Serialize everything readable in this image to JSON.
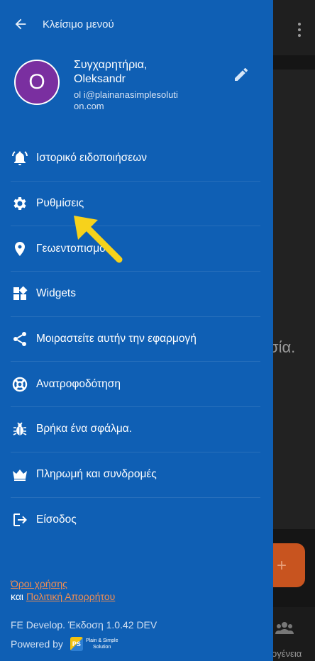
{
  "drawer": {
    "close_label": "Κλείσιμο μενού",
    "profile": {
      "avatar_letter": "O",
      "greeting_line1": "Συγχαρητήρια,",
      "greeting_line2": "Oleksandr",
      "email": "ol             i@plainanasimplesolution.com"
    },
    "menu": [
      {
        "icon": "bell-ringing-icon",
        "label": "Ιστορικό ειδοποιήσεων"
      },
      {
        "icon": "gear-icon",
        "label": "Ρυθμίσεις"
      },
      {
        "icon": "location-pin-icon",
        "label": "Γεωεντοπισμός"
      },
      {
        "icon": "widgets-icon",
        "label": "Widgets"
      },
      {
        "icon": "share-icon",
        "label": "Μοιραστείτε αυτήν την εφαρμογή"
      },
      {
        "icon": "lifebuoy-icon",
        "label": "Ανατροφοδότηση"
      },
      {
        "icon": "bug-icon",
        "label": "Βρήκα ένα σφάλμα."
      },
      {
        "icon": "crown-icon",
        "label": "Πληρωμή και συνδρομές"
      },
      {
        "icon": "login-icon",
        "label": "Είσοδος"
      }
    ],
    "footer": {
      "terms_link": "Όροι χρήσης",
      "and_text": "και",
      "privacy_link": "Πολιτική Απορρήτου",
      "version": "FE Develop. Έκδοση 1.0.42 DEV",
      "powered_by": "Powered by",
      "logo_mark": "PS",
      "logo_text_line1": "Plain & Simple",
      "logo_text_line2": "Solution"
    }
  },
  "background": {
    "card_text": "σία.",
    "bottom_label": "ογένεια",
    "fab_symbol": "+"
  },
  "colors": {
    "drawer_bg": "#0f5fb4",
    "link": "#ef8d53",
    "avatar_bg": "#7a2fa0",
    "annotation_arrow": "#f7d21b"
  }
}
